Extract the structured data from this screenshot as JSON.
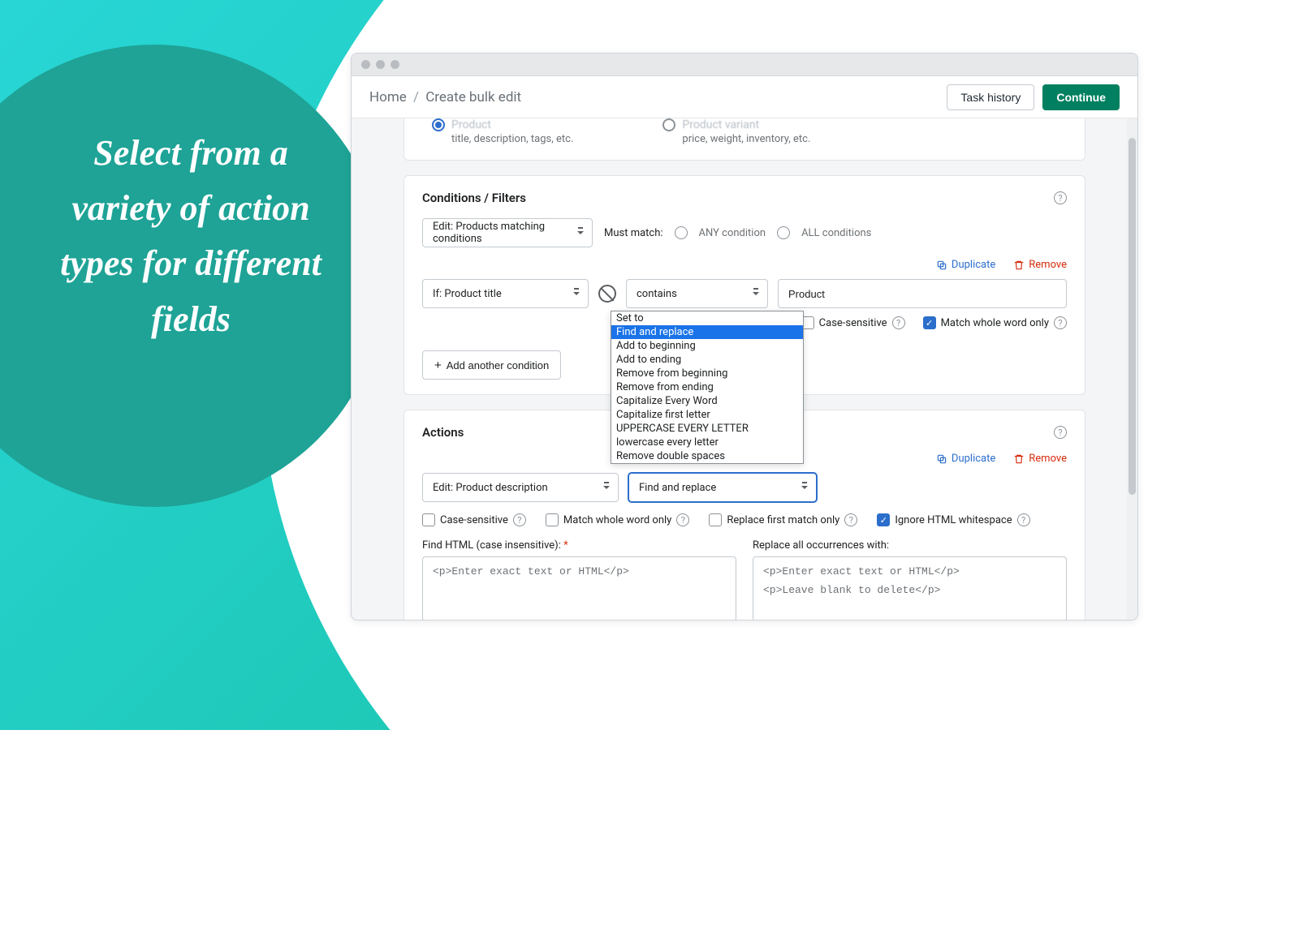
{
  "headline": "Select from a variety of action types for different fields",
  "breadcrumb": {
    "home": "Home",
    "sep": "/",
    "current": "Create bulk edit"
  },
  "header": {
    "task_history": "Task history",
    "continue": "Continue"
  },
  "top_options": {
    "product": {
      "label": "Product",
      "sub": "title, description, tags, etc."
    },
    "variant": {
      "label": "Product variant",
      "sub": "price, weight, inventory, etc."
    }
  },
  "conditions": {
    "title": "Conditions / Filters",
    "edit_select": "Edit: Products matching conditions",
    "must_match": "Must match:",
    "any": "ANY condition",
    "all": "ALL conditions",
    "duplicate": "Duplicate",
    "remove": "Remove",
    "if_select": "If: Product title",
    "operator_select": "contains",
    "value": "Product",
    "case_sensitive": "Case-sensitive",
    "match_whole": "Match whole word only",
    "add_another": "Add another condition"
  },
  "actions": {
    "title": "Actions",
    "duplicate": "Duplicate",
    "remove": "Remove",
    "edit_select": "Edit: Product description",
    "action_select": "Find and replace",
    "case_sensitive": "Case-sensitive",
    "match_whole": "Match whole word only",
    "replace_first": "Replace first match only",
    "ignore_ws": "Ignore HTML whitespace",
    "find_label": "Find HTML (case insensitive): ",
    "find_req": "*",
    "replace_label": "Replace all occurrences with:",
    "find_placeholder": "<p>Enter exact text or HTML</p>",
    "replace_placeholder_l1": "<p>Enter exact text or HTML</p>",
    "replace_placeholder_l2": "<p>Leave blank to delete</p>"
  },
  "dropdown_options": [
    "Set to",
    "Find and replace",
    "Add to beginning",
    "Add to ending",
    "Remove from beginning",
    "Remove from ending",
    "Capitalize Every Word",
    "Capitalize first letter",
    "UPPERCASE EVERY LETTER",
    "lowercase every letter",
    "Remove double spaces"
  ],
  "dropdown_selected_index": 1
}
